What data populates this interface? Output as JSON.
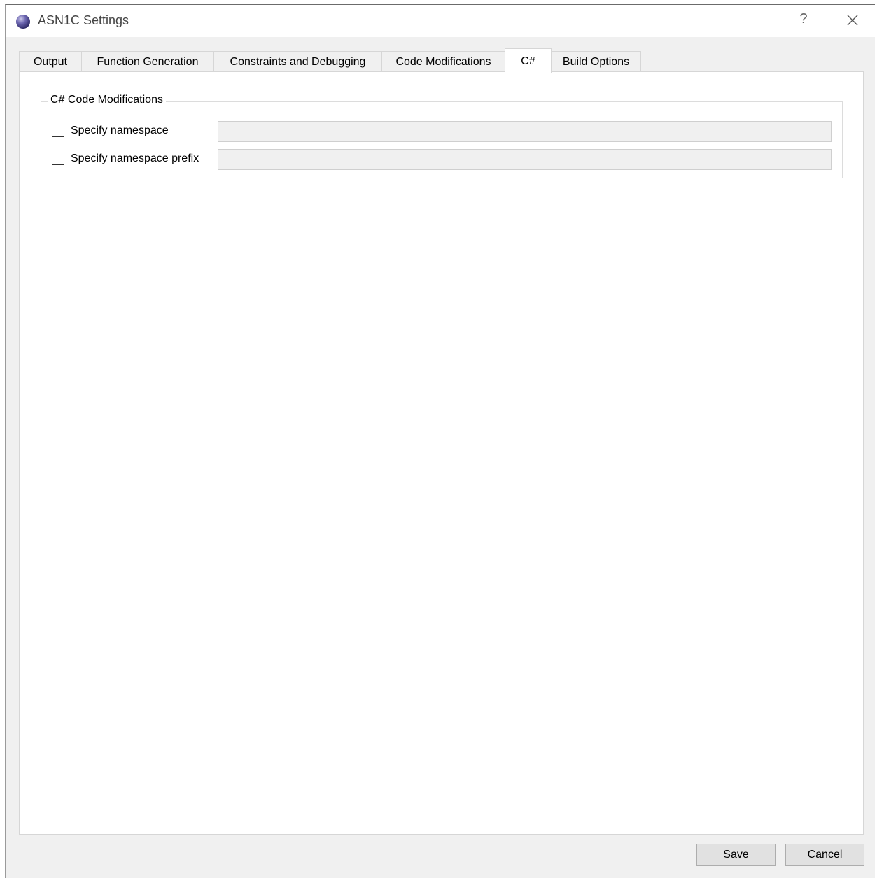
{
  "window": {
    "title": "ASN1C Settings",
    "help_glyph": "?",
    "icons": {
      "app": "asn1c-sphere-icon",
      "close": "close-icon"
    }
  },
  "tabs": [
    {
      "label": "Output",
      "active": false
    },
    {
      "label": "Function Generation",
      "active": false
    },
    {
      "label": "Constraints and Debugging",
      "active": false
    },
    {
      "label": "Code Modifications",
      "active": false
    },
    {
      "label": "C#",
      "active": true
    },
    {
      "label": "Build Options",
      "active": false
    }
  ],
  "group": {
    "title": "C# Code Modifications",
    "options": [
      {
        "label": "Specify namespace",
        "checked": false,
        "value": "",
        "enabled": false
      },
      {
        "label": "Specify namespace prefix",
        "checked": false,
        "value": "",
        "enabled": false
      }
    ]
  },
  "buttons": {
    "save": "Save",
    "cancel": "Cancel"
  }
}
